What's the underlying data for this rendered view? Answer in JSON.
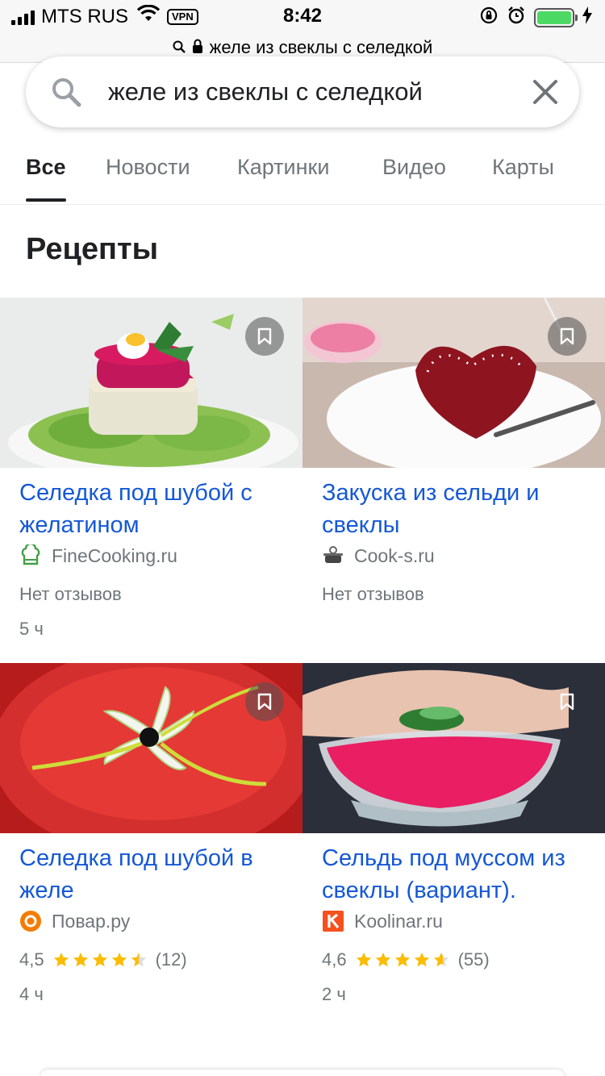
{
  "status_bar": {
    "carrier": "MTS RUS",
    "vpn": "VPN",
    "time": "8:42"
  },
  "url_bar": {
    "text": "желе из свеклы с селедкой"
  },
  "search": {
    "query": "желе из свеклы с селедкой"
  },
  "tabs": [
    {
      "label": "Все",
      "active": true
    },
    {
      "label": "Новости"
    },
    {
      "label": "Картинки"
    },
    {
      "label": "Видео"
    },
    {
      "label": "Карты"
    }
  ],
  "section": {
    "title": "Рецепты"
  },
  "recipes": [
    {
      "title": "Селедка под шубой с желатином",
      "source": "FineCooking.ru",
      "rating_text": "Нет отзывов",
      "time": "5 ч"
    },
    {
      "title": "Закуска из сельди и свеклы",
      "source": "Cook-s.ru",
      "rating_text": "Нет отзывов"
    },
    {
      "title": "Селедка под шубой в желе",
      "source": "Повар.ру",
      "rating": "4,5",
      "reviews": "(12)",
      "time": "4 ч"
    },
    {
      "title": "Сельдь под муссом из свеклы (вариант).",
      "source": "Koolinar.ru",
      "rating": "4,6",
      "reviews": "(55)",
      "time": "2 ч"
    }
  ],
  "colors": {
    "link": "#1558d6",
    "star": "#fbbc04",
    "battery": "#4cd964"
  }
}
